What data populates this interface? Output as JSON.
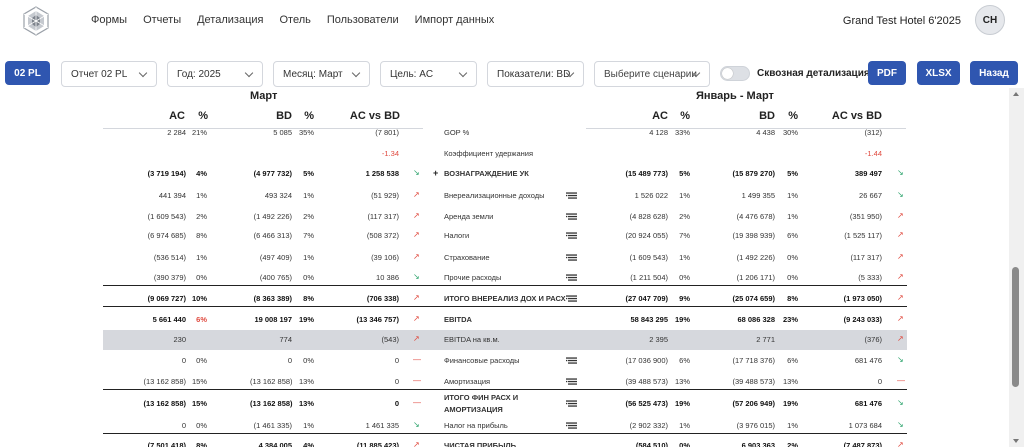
{
  "nav": [
    "Формы",
    "Отчеты",
    "Детализация",
    "Отель",
    "Пользователи",
    "Импорт данных"
  ],
  "hotel": "Grand Test Hotel 6'2025",
  "avatar": "CH",
  "filters": {
    "report_btn": "02 PL",
    "report": "Отчет 02 PL",
    "year": "Год: 2025",
    "month": "Месяц: Март",
    "target": "Цель: AC",
    "metrics": "Показатели: BD",
    "scenarios": "Выберите сценарии",
    "toggle_label": "Сквозная детализация",
    "pdf": "PDF",
    "xlsx": "XLSX",
    "back": "Назад"
  },
  "periods": {
    "left": "Март",
    "right": "Январь - Март"
  },
  "cols": {
    "ac": "AC",
    "pct": "%",
    "bd": "BD",
    "diff": "AC vs BD"
  },
  "rows": [
    {
      "ac": "2 284",
      "acp": "21%",
      "bd": "5 085",
      "bdp": "35%",
      "d": "(7 801)",
      "lbl": "GOP %",
      "rac": "4 128",
      "racp": "33%",
      "rbd": "4 438",
      "rbdp": "30%",
      "rd": "(312)",
      "cut": true
    },
    {
      "d": "-1.34",
      "dred": true,
      "lbl": "Коэффициент удержания",
      "rd": "-1.44",
      "rdred": true
    },
    {
      "ac": "(3 719 194)",
      "acp": "4%",
      "bd": "(4 977 732)",
      "bdp": "5%",
      "d": "1 258 538",
      "arr": "down",
      "lbl": "ВОЗНАГРАЖДЕНИЕ УК",
      "plus": "+",
      "rac": "(15 489 773)",
      "racp": "5%",
      "rbd": "(15 879 270)",
      "rbdp": "5%",
      "rd": "389 497",
      "rarr": "down",
      "bold": true
    },
    {
      "ac": "441 394",
      "acp": "1%",
      "bd": "493 324",
      "bdp": "1%",
      "d": "(51 929)",
      "arr": "up",
      "lbl": "Внереализационные доходы",
      "menu": true,
      "rac": "1 526 022",
      "racp": "1%",
      "rbd": "1 499 355",
      "rbdp": "1%",
      "rd": "26 667",
      "rarr": "down"
    },
    {
      "ac": "(1 609 543)",
      "acp": "2%",
      "bd": "(1 492 226)",
      "bdp": "2%",
      "d": "(117 317)",
      "arr": "up",
      "lbl": "Аренда земли",
      "menu": true,
      "rac": "(4 828 628)",
      "racp": "2%",
      "rbd": "(4 476 678)",
      "rbdp": "1%",
      "rd": "(351 950)",
      "rarr": "up"
    },
    {
      "ac": "(6 974 685)",
      "acp": "8%",
      "bd": "(6 466 313)",
      "bdp": "7%",
      "d": "(508 372)",
      "arr": "up",
      "lbl": "Налоги",
      "menu": true,
      "rac": "(20 924 055)",
      "racp": "7%",
      "rbd": "(19 398 939)",
      "rbdp": "6%",
      "rd": "(1 525 117)",
      "rarr": "up"
    },
    {
      "ac": "(536 514)",
      "acp": "1%",
      "bd": "(497 409)",
      "bdp": "1%",
      "d": "(39 106)",
      "arr": "up",
      "lbl": "Страхование",
      "menu": true,
      "rac": "(1 609 543)",
      "racp": "1%",
      "rbd": "(1 492 226)",
      "rbdp": "0%",
      "rd": "(117 317)",
      "rarr": "up"
    },
    {
      "ac": "(390 379)",
      "acp": "0%",
      "bd": "(400 765)",
      "bdp": "0%",
      "d": "10 386",
      "arr": "down",
      "lbl": "Прочие расходы",
      "menu": true,
      "rac": "(1 211 504)",
      "racp": "0%",
      "rbd": "(1 206 171)",
      "rbdp": "0%",
      "rd": "(5 333)",
      "rarr": "up"
    },
    {
      "ac": "(9 069 727)",
      "acp": "10%",
      "bd": "(8 363 389)",
      "bdp": "8%",
      "d": "(706 338)",
      "arr": "up",
      "lbl": "ИТОГО ВНЕРЕАЛИЗ ДОХ И РАСХ",
      "menu": true,
      "rac": "(27 047 709)",
      "racp": "9%",
      "rbd": "(25 074 659)",
      "rbdp": "8%",
      "rd": "(1 973 050)",
      "rarr": "up",
      "bold": true,
      "line": true
    },
    {
      "ac": "5 661 440",
      "acp": "6%",
      "acpred": true,
      "bd": "19 008 197",
      "bdp": "19%",
      "d": "(13 346 757)",
      "arr": "up",
      "lbl": "EBITDA",
      "rac": "58 843 295",
      "racp": "19%",
      "rbd": "68 086 328",
      "rbdp": "23%",
      "rd": "(9 243 033)",
      "rarr": "up",
      "bold": true,
      "line": true
    },
    {
      "ac": "230",
      "bd": "774",
      "d": "(543)",
      "arr": "up",
      "lbl": "EBITDA на кв.м.",
      "rac": "2 395",
      "rbd": "2 771",
      "rd": "(376)",
      "rarr": "up",
      "gray": true
    },
    {
      "ac": "0",
      "acp": "0%",
      "bd": "0",
      "bdp": "0%",
      "d": "0",
      "arr": "flat",
      "arrtxt": "—",
      "lbl": "Финансовые расходы",
      "menu": true,
      "rac": "(17 036 900)",
      "racp": "6%",
      "rbd": "(17 718 376)",
      "rbdp": "6%",
      "rd": "681 476",
      "rarr": "down"
    },
    {
      "ac": "(13 162 858)",
      "acp": "15%",
      "bd": "(13 162 858)",
      "bdp": "13%",
      "d": "0",
      "arr": "flat",
      "arrtxt": "—",
      "lbl": "Амортизация",
      "menu": true,
      "rac": "(39 488 573)",
      "racp": "13%",
      "rbd": "(39 488 573)",
      "rbdp": "13%",
      "rd": "0",
      "rarr": "flat",
      "rarrtxt": "—"
    },
    {
      "ac": "(13 162 858)",
      "acp": "15%",
      "bd": "(13 162 858)",
      "bdp": "13%",
      "d": "0",
      "arr": "flat",
      "arrtxt": "—",
      "lbl": "ИТОГО ФИН РАСХ И",
      "lbl2": "АМОРТИЗАЦИЯ",
      "menu": true,
      "rac": "(56 525 473)",
      "racp": "19%",
      "rbd": "(57 206 949)",
      "rbdp": "19%",
      "rd": "681 476",
      "rarr": "down",
      "bold": true,
      "line": true,
      "tall": true
    },
    {
      "ac": "0",
      "acp": "0%",
      "bd": "(1 461 335)",
      "bdp": "1%",
      "d": "1 461 335",
      "arr": "down",
      "lbl": "Налог на прибыль",
      "menu": true,
      "rac": "(2 902 332)",
      "racp": "1%",
      "rbd": "(3 976 015)",
      "rbdp": "1%",
      "rd": "1 073 684",
      "rarr": "down"
    },
    {
      "ac": "(7 501 418)",
      "acp": "8%",
      "bd": "4 384 005",
      "bdp": "4%",
      "d": "(11 885 423)",
      "arr": "up",
      "lbl": "ЧИСТАЯ ПРИБЫЛЬ",
      "rac": "(584 510)",
      "racp": "0%",
      "rbd": "6 903 363",
      "rbdp": "2%",
      "rd": "(7 487 873)",
      "rarr": "up",
      "bold": true,
      "line": true
    }
  ]
}
